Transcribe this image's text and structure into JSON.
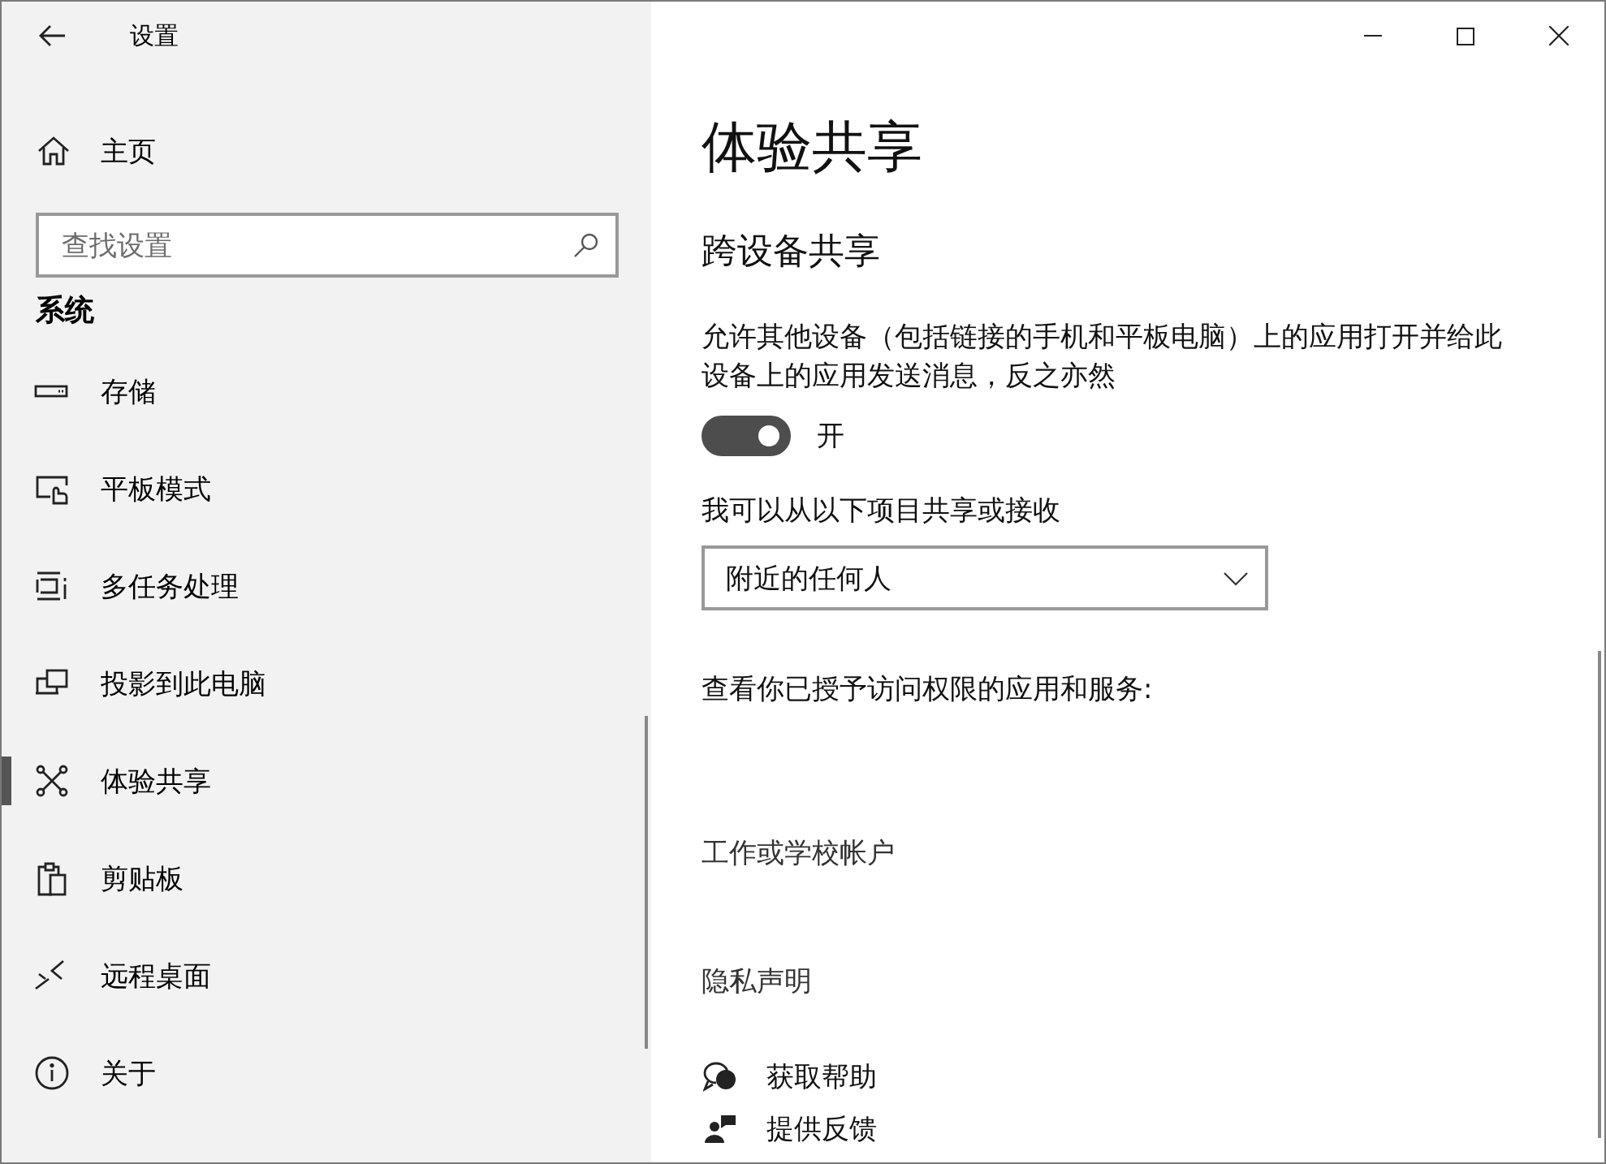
{
  "window": {
    "title": "设置"
  },
  "sidebar": {
    "home": {
      "label": "主页"
    },
    "search": {
      "placeholder": "查找设置"
    },
    "section": "系统",
    "items": [
      {
        "label": "存储",
        "selected": false
      },
      {
        "label": "平板模式",
        "selected": false
      },
      {
        "label": "多任务处理",
        "selected": false
      },
      {
        "label": "投影到此电脑",
        "selected": false
      },
      {
        "label": "体验共享",
        "selected": true
      },
      {
        "label": "剪贴板",
        "selected": false
      },
      {
        "label": "远程桌面",
        "selected": false
      },
      {
        "label": "关于",
        "selected": false
      }
    ]
  },
  "main": {
    "title": "体验共享",
    "section": "跨设备共享",
    "description": "允许其他设备（包括链接的手机和平板电脑）上的应用打开并给此设备上的应用发送消息，反之亦然",
    "toggle": {
      "on": true,
      "label": "开"
    },
    "share_label": "我可以从以下项目共享或接收",
    "dropdown": {
      "value": "附近的任何人"
    },
    "apps_label": "查看你已授予访问权限的应用和服务:",
    "account_link": "工作或学校帐户",
    "privacy_link": "隐私声明",
    "help": [
      {
        "label": "获取帮助"
      },
      {
        "label": "提供反馈"
      }
    ]
  }
}
